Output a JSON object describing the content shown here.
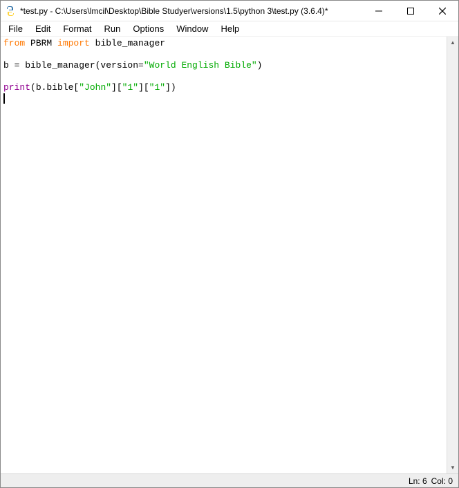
{
  "window": {
    "title": "*test.py - C:\\Users\\lmcil\\Desktop\\Bible Studyer\\versions\\1.5\\python 3\\test.py (3.6.4)*"
  },
  "menu": {
    "items": [
      "File",
      "Edit",
      "Format",
      "Run",
      "Options",
      "Window",
      "Help"
    ]
  },
  "code": {
    "tokens": {
      "from": "from",
      "pbrm": " PBRM ",
      "import": "import",
      "bm": " bible_manager",
      "assign": "b = bible_manager(version=",
      "ver_str": "\"World English Bible\"",
      "close_paren": ")",
      "print": "print",
      "after_print": "(b.bible[",
      "john": "\"John\"",
      "br1": "][",
      "one1": "\"1\"",
      "br2": "][",
      "one2": "\"1\"",
      "end": "])"
    }
  },
  "status": {
    "ln": "Ln: 6",
    "col": "Col: 0"
  }
}
